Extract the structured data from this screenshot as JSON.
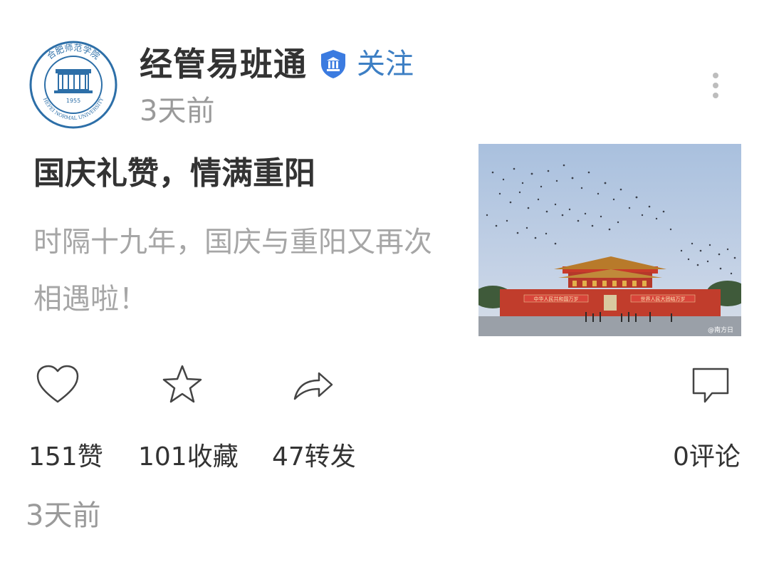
{
  "header": {
    "avatar_text_top": "合肥师范学院",
    "avatar_text_bottom": "HEFEI NORMAL UNIVERSITY",
    "avatar_year": "1955",
    "account_name": "经管易班通",
    "verified_icon": "shield-bank-icon",
    "follow_label": "关注",
    "post_time": "3天前",
    "more_icon": "vertical-ellipsis-icon"
  },
  "post": {
    "title": "国庆礼赞，情满重阳",
    "summary": "时隔十九年，国庆与重阳又再次相遇啦！",
    "thumbnail": {
      "banner_left": "中华人民共和国万岁",
      "banner_right": "世界人民大团结万岁",
      "watermark": "@南方日"
    }
  },
  "actions": {
    "like": {
      "icon": "heart-icon",
      "label": "151赞"
    },
    "favorite": {
      "icon": "star-icon",
      "label": "101收藏"
    },
    "share": {
      "icon": "share-arrow-icon",
      "label": "47转发"
    },
    "comment": {
      "icon": "comment-bubble-icon",
      "label": "0评论"
    }
  },
  "footer": {
    "time": "3天前"
  },
  "colors": {
    "accent": "#3d7fc4",
    "muted": "#9a9a9a",
    "badge": "#3b7be0"
  }
}
